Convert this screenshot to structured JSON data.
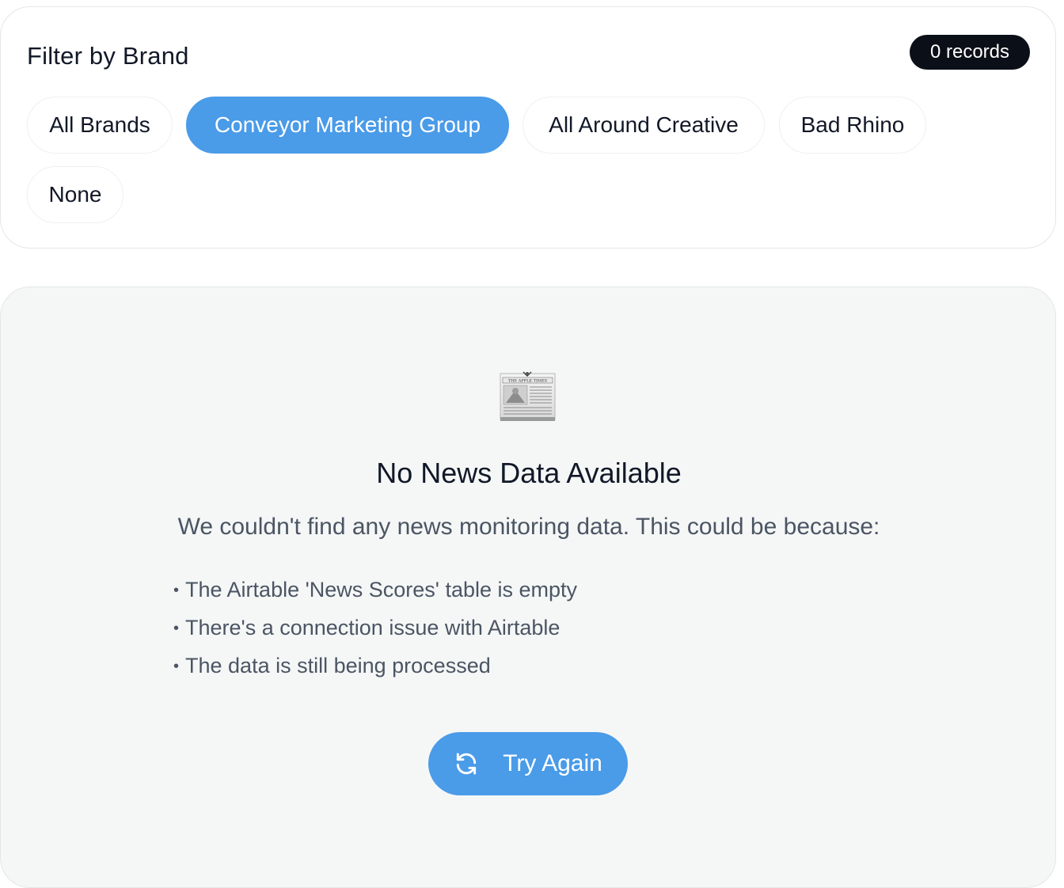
{
  "filter": {
    "title": "Filter by Brand",
    "records_badge": "0 records",
    "brands": [
      {
        "label": "All Brands",
        "active": false
      },
      {
        "label": "Conveyor Marketing Group",
        "active": true
      },
      {
        "label": "All Around Creative",
        "active": false
      },
      {
        "label": "Bad Rhino",
        "active": false
      },
      {
        "label": "None",
        "active": false
      }
    ]
  },
  "empty_state": {
    "icon": "newspaper-icon",
    "icon_masthead": "THE APPLE TIMES",
    "title": "No News Data Available",
    "description": "We couldn't find any news monitoring data. This could be because:",
    "reasons": [
      "The Airtable 'News Scores' table is empty",
      "There's a connection issue with Airtable",
      "The data is still being processed"
    ],
    "retry_button": {
      "label": "Try Again",
      "icon": "refresh-icon"
    }
  },
  "colors": {
    "accent": "#4a9be8",
    "badge_bg": "#0b0f17",
    "card_bg": "#f5f7f7",
    "text_primary": "#111827",
    "text_secondary": "#4b5563"
  }
}
